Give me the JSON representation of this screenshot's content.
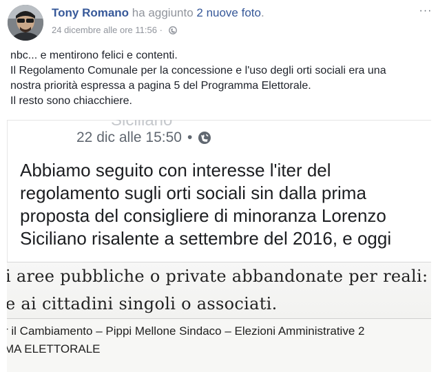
{
  "post": {
    "author": "Tony Romano",
    "action_prefix": " ha aggiunto ",
    "action_link": "2 nuove foto",
    "action_suffix": ".",
    "timestamp": "24 dicembre alle ore 11:56",
    "meta_separator": " · ",
    "privacy_icon": "globe-icon",
    "more_menu": "···",
    "text_lines": [
      "nbc... e mentirono felici e contenti.",
      "Il Regolamento Comunale per la concessione e l'uso degli orti sociali era una",
      "nostra priorità espressa a pagina 5 del Programma Elettorale.",
      "Il resto sono chiacchiere."
    ]
  },
  "attachment": {
    "shot1": {
      "top_fragment": "Siciliano",
      "time": "22 dic alle 15:50",
      "dot": "•",
      "body_lines": [
        "Abbiamo seguito con interesse l'iter del",
        "regolamento sugli orti sociali sin dalla prima",
        "proposta del consigliere di minoranza Lorenzo",
        "Siciliano risalente a settembre del 2016, e oggi"
      ]
    },
    "shot2": {
      "lines": [
        "i aree pubbliche o private abbandonate per reali:",
        "e ai cittadini singoli o associati."
      ]
    },
    "shot3": {
      "lines": [
        "r il Cambiamento – Pippi Mellone Sindaco – Elezioni Amministrative 2",
        "MA ELETTORALE"
      ]
    }
  },
  "colors": {
    "link": "#365899",
    "muted": "#90949c",
    "text": "#1d2129"
  }
}
